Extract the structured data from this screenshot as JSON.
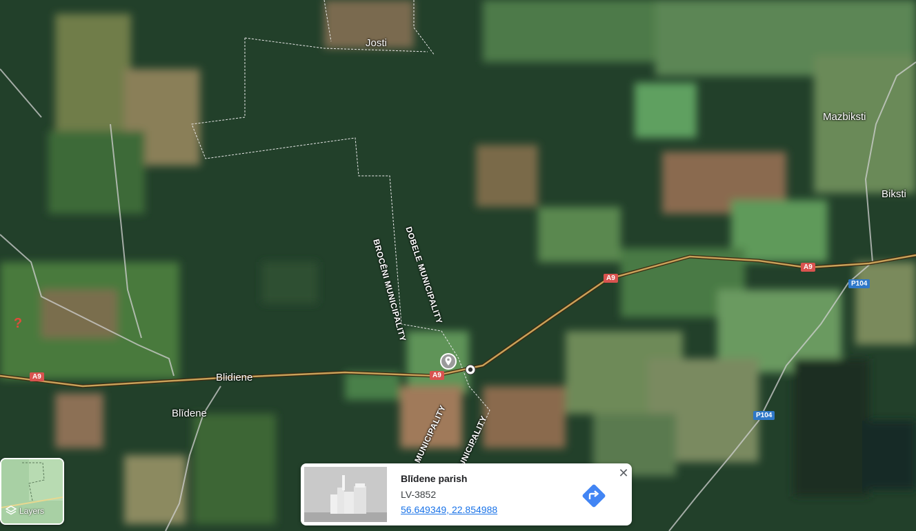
{
  "map": {
    "type": "satellite",
    "places": {
      "josti": "Josti",
      "mazbiksti": "Mazbiksti",
      "biksti": "Biksti",
      "blidiene": "Blidiene",
      "blidene": "Blīdene"
    },
    "municipalities": {
      "broceni_upper": "BROCĒNI MUNICIPALITY",
      "dobele_upper": "DOBELE MUNICIPALITY",
      "broceni_lower": "BROCĒNI MUNICIPALITY",
      "dobele_lower": "DOBELE MUNICIPALITY"
    },
    "roads": {
      "a9_1": "A9",
      "a9_2": "A9",
      "a9_3": "A9",
      "a9_4": "A9",
      "p104_1": "P104",
      "p104_2": "P104"
    },
    "colors": {
      "road_main": "#c9a25a",
      "road_minor": "#d0d0d0",
      "boundary": "#e8e8e8"
    }
  },
  "layers": {
    "label": "Layers",
    "icon": "layers-icon"
  },
  "info_card": {
    "title": "Blīdene parish",
    "postal_code": "LV-3852",
    "coordinates": "56.649349, 22.854988",
    "directions_icon": "directions-icon",
    "close_icon": "close-icon",
    "close_glyph": "✕"
  }
}
